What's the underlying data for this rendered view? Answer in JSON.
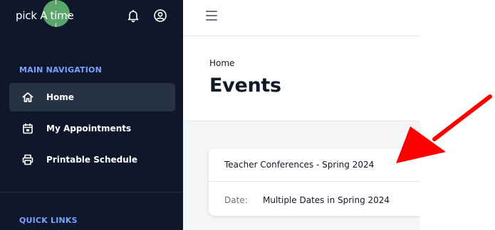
{
  "app": {
    "logo_part1": "pick A",
    "logo_part2": "time"
  },
  "sidebar": {
    "main_heading": "MAIN NAVIGATION",
    "quick_heading": "QUICK LINKS",
    "items": [
      {
        "label": "Home",
        "icon": "home-icon",
        "active": true
      },
      {
        "label": "My Appointments",
        "icon": "calendar-icon",
        "active": false
      },
      {
        "label": "Printable Schedule",
        "icon": "printer-icon",
        "active": false
      }
    ]
  },
  "header": {
    "breadcrumb": "Home",
    "title": "Events"
  },
  "events": [
    {
      "title": "Teacher Conferences - Spring 2024",
      "date_label": "Date:",
      "date_value": "Multiple Dates in Spring 2024"
    }
  ],
  "colors": {
    "sidebar_bg": "#0f172a",
    "accent_heading": "#7aa2ff",
    "logo_green": "#5aa66b",
    "annotation_arrow": "#ff0000"
  }
}
